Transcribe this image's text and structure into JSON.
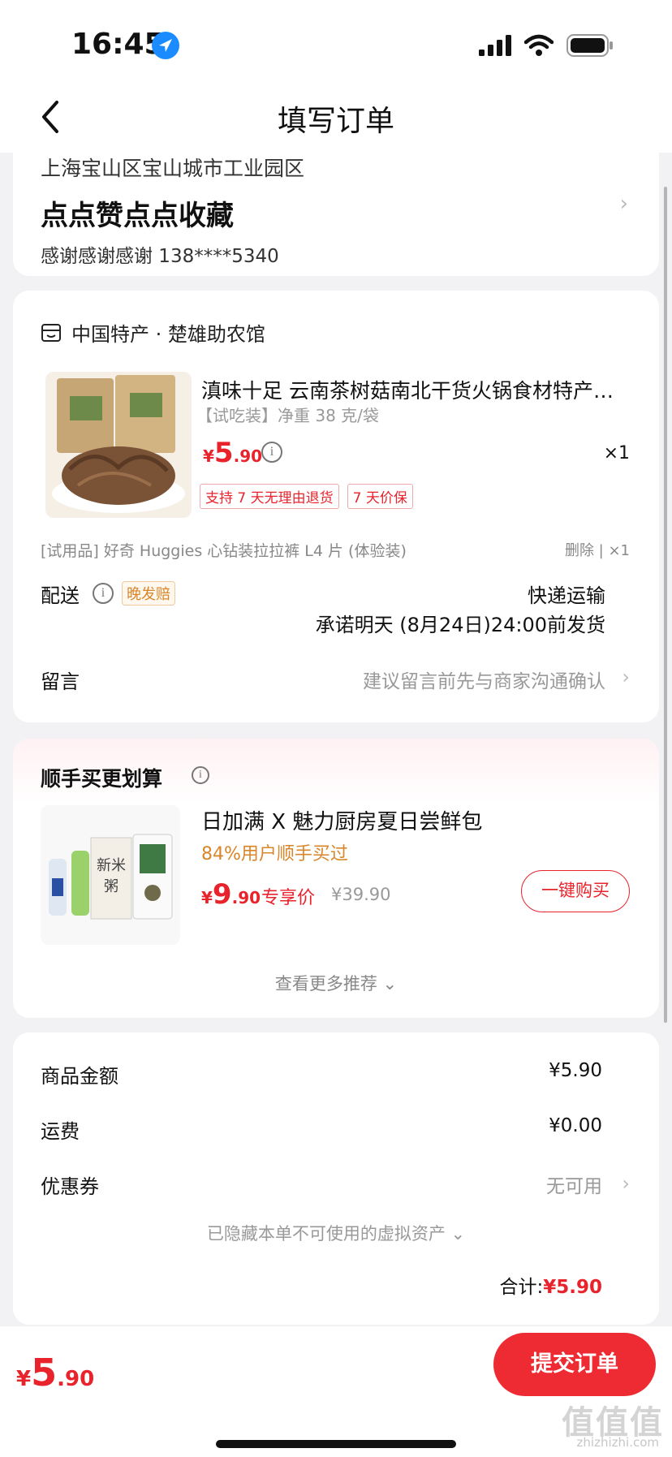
{
  "status_bar": {
    "time": "16:45"
  },
  "nav": {
    "title": "填写订单"
  },
  "address": {
    "region": "上海宝山区宝山城市工业园区",
    "detail": "点点赞点点收藏",
    "contact": "感谢感谢感谢  138****5340"
  },
  "order": {
    "store_name": "中国特产 · 楚雄助农馆",
    "product": {
      "title": "滇味十足 云南茶树菇南北干货火锅食材特产…",
      "spec": "【试吃装】净重 38 克/袋",
      "price_symbol": "¥",
      "price_int": "5",
      "price_dec": ".90",
      "qty": "×1",
      "tags": [
        "支持 7 天无理由退货",
        "7 天价保"
      ]
    },
    "trial": {
      "text": "[试用品]  好奇 Huggies 心钻装拉拉裤 L4 片 (体验装)",
      "right": "删除 | ×1"
    },
    "shipping": {
      "label": "配送",
      "badge": "晚发赔",
      "method": "快递运输",
      "promise": "承诺明天 (8月24日)24:00前发货"
    },
    "message": {
      "label": "留言",
      "hint": "建议留言前先与商家沟通确认"
    }
  },
  "recommend": {
    "title": "顺手买更划算",
    "name": "日加满 X 魅力厨房夏日尝鲜包",
    "subtitle": "84%用户顺手买过",
    "price_symbol": "¥",
    "price_int": "9",
    "price_dec": ".90",
    "exclusive": "专享价",
    "orig_price": "¥39.90",
    "buy_label": "一键购买",
    "more": "查看更多推荐 ⌄"
  },
  "summary": {
    "rows": [
      {
        "label": "商品金额",
        "value": "¥5.90"
      },
      {
        "label": "运费",
        "value": "¥0.00"
      },
      {
        "label": "优惠券",
        "value": "无可用"
      }
    ],
    "hidden_assets": "已隐藏本单不可使用的虚拟资产 ⌄",
    "total_label": "合计:",
    "total_value": "¥5.90"
  },
  "bottom": {
    "price_symbol": "¥",
    "price_int": "5",
    "price_dec": ".90",
    "submit_label": "提交订单"
  },
  "watermark": {
    "text": "值值值",
    "sub": "zhizhizhi.com"
  },
  "colors": {
    "accent": "#e8232c",
    "secondary": "#d9862b",
    "background": "#f2f2f4"
  }
}
